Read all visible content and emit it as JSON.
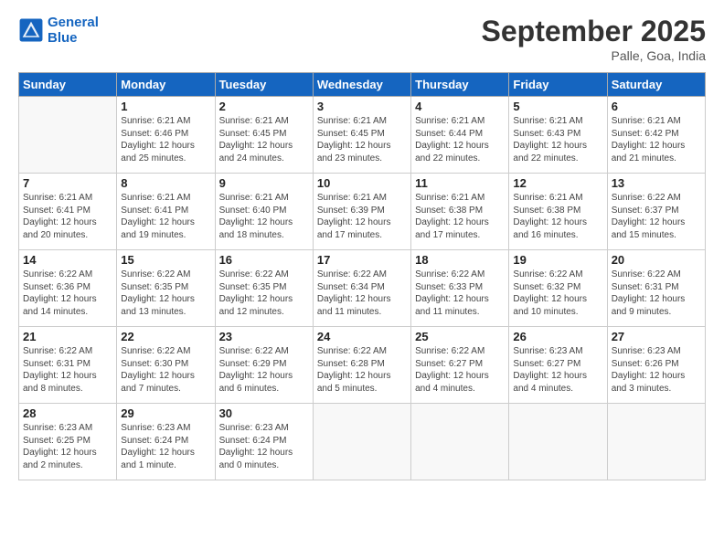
{
  "logo": {
    "line1": "General",
    "line2": "Blue"
  },
  "title": "September 2025",
  "subtitle": "Palle, Goa, India",
  "days_header": [
    "Sunday",
    "Monday",
    "Tuesday",
    "Wednesday",
    "Thursday",
    "Friday",
    "Saturday"
  ],
  "weeks": [
    [
      {
        "num": "",
        "info": ""
      },
      {
        "num": "1",
        "info": "Sunrise: 6:21 AM\nSunset: 6:46 PM\nDaylight: 12 hours\nand 25 minutes."
      },
      {
        "num": "2",
        "info": "Sunrise: 6:21 AM\nSunset: 6:45 PM\nDaylight: 12 hours\nand 24 minutes."
      },
      {
        "num": "3",
        "info": "Sunrise: 6:21 AM\nSunset: 6:45 PM\nDaylight: 12 hours\nand 23 minutes."
      },
      {
        "num": "4",
        "info": "Sunrise: 6:21 AM\nSunset: 6:44 PM\nDaylight: 12 hours\nand 22 minutes."
      },
      {
        "num": "5",
        "info": "Sunrise: 6:21 AM\nSunset: 6:43 PM\nDaylight: 12 hours\nand 22 minutes."
      },
      {
        "num": "6",
        "info": "Sunrise: 6:21 AM\nSunset: 6:42 PM\nDaylight: 12 hours\nand 21 minutes."
      }
    ],
    [
      {
        "num": "7",
        "info": "Sunrise: 6:21 AM\nSunset: 6:41 PM\nDaylight: 12 hours\nand 20 minutes."
      },
      {
        "num": "8",
        "info": "Sunrise: 6:21 AM\nSunset: 6:41 PM\nDaylight: 12 hours\nand 19 minutes."
      },
      {
        "num": "9",
        "info": "Sunrise: 6:21 AM\nSunset: 6:40 PM\nDaylight: 12 hours\nand 18 minutes."
      },
      {
        "num": "10",
        "info": "Sunrise: 6:21 AM\nSunset: 6:39 PM\nDaylight: 12 hours\nand 17 minutes."
      },
      {
        "num": "11",
        "info": "Sunrise: 6:21 AM\nSunset: 6:38 PM\nDaylight: 12 hours\nand 17 minutes."
      },
      {
        "num": "12",
        "info": "Sunrise: 6:21 AM\nSunset: 6:38 PM\nDaylight: 12 hours\nand 16 minutes."
      },
      {
        "num": "13",
        "info": "Sunrise: 6:22 AM\nSunset: 6:37 PM\nDaylight: 12 hours\nand 15 minutes."
      }
    ],
    [
      {
        "num": "14",
        "info": "Sunrise: 6:22 AM\nSunset: 6:36 PM\nDaylight: 12 hours\nand 14 minutes."
      },
      {
        "num": "15",
        "info": "Sunrise: 6:22 AM\nSunset: 6:35 PM\nDaylight: 12 hours\nand 13 minutes."
      },
      {
        "num": "16",
        "info": "Sunrise: 6:22 AM\nSunset: 6:35 PM\nDaylight: 12 hours\nand 12 minutes."
      },
      {
        "num": "17",
        "info": "Sunrise: 6:22 AM\nSunset: 6:34 PM\nDaylight: 12 hours\nand 11 minutes."
      },
      {
        "num": "18",
        "info": "Sunrise: 6:22 AM\nSunset: 6:33 PM\nDaylight: 12 hours\nand 11 minutes."
      },
      {
        "num": "19",
        "info": "Sunrise: 6:22 AM\nSunset: 6:32 PM\nDaylight: 12 hours\nand 10 minutes."
      },
      {
        "num": "20",
        "info": "Sunrise: 6:22 AM\nSunset: 6:31 PM\nDaylight: 12 hours\nand 9 minutes."
      }
    ],
    [
      {
        "num": "21",
        "info": "Sunrise: 6:22 AM\nSunset: 6:31 PM\nDaylight: 12 hours\nand 8 minutes."
      },
      {
        "num": "22",
        "info": "Sunrise: 6:22 AM\nSunset: 6:30 PM\nDaylight: 12 hours\nand 7 minutes."
      },
      {
        "num": "23",
        "info": "Sunrise: 6:22 AM\nSunset: 6:29 PM\nDaylight: 12 hours\nand 6 minutes."
      },
      {
        "num": "24",
        "info": "Sunrise: 6:22 AM\nSunset: 6:28 PM\nDaylight: 12 hours\nand 5 minutes."
      },
      {
        "num": "25",
        "info": "Sunrise: 6:22 AM\nSunset: 6:27 PM\nDaylight: 12 hours\nand 4 minutes."
      },
      {
        "num": "26",
        "info": "Sunrise: 6:23 AM\nSunset: 6:27 PM\nDaylight: 12 hours\nand 4 minutes."
      },
      {
        "num": "27",
        "info": "Sunrise: 6:23 AM\nSunset: 6:26 PM\nDaylight: 12 hours\nand 3 minutes."
      }
    ],
    [
      {
        "num": "28",
        "info": "Sunrise: 6:23 AM\nSunset: 6:25 PM\nDaylight: 12 hours\nand 2 minutes."
      },
      {
        "num": "29",
        "info": "Sunrise: 6:23 AM\nSunset: 6:24 PM\nDaylight: 12 hours\nand 1 minute."
      },
      {
        "num": "30",
        "info": "Sunrise: 6:23 AM\nSunset: 6:24 PM\nDaylight: 12 hours\nand 0 minutes."
      },
      {
        "num": "",
        "info": ""
      },
      {
        "num": "",
        "info": ""
      },
      {
        "num": "",
        "info": ""
      },
      {
        "num": "",
        "info": ""
      }
    ]
  ]
}
